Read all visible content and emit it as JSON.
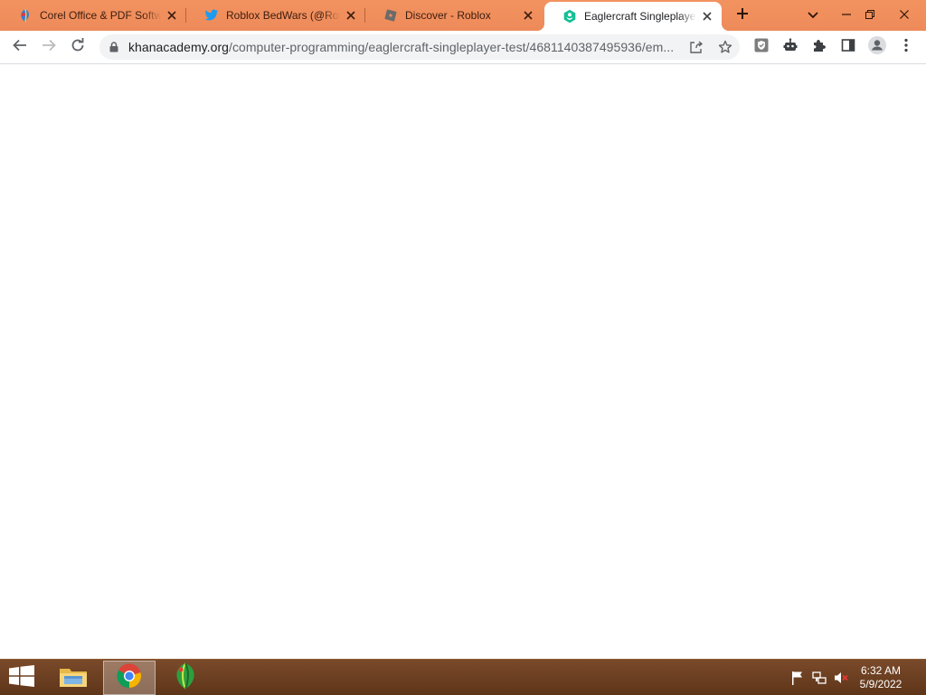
{
  "browser": {
    "tabs": [
      {
        "title": "Corel Office & PDF Software",
        "icon": "corel-favicon",
        "active": false
      },
      {
        "title": "Roblox BedWars (@Roblox_BedWars)",
        "icon": "twitter-favicon",
        "active": false
      },
      {
        "title": "Discover - Roblox",
        "icon": "roblox-favicon",
        "active": false
      },
      {
        "title": "Eaglercraft Singleplayer Test",
        "icon": "khan-academy-favicon",
        "active": true
      }
    ],
    "new_tab_icon": "plus-icon",
    "tab_search_icon": "chevron-down-icon"
  },
  "toolbar": {
    "url_host": "khanacademy.org",
    "url_path": "/computer-programming/eaglercraft-singleplayer-test/4681140387495936/em...",
    "icons": [
      "back-arrow-icon",
      "forward-arrow-icon",
      "reload-icon",
      "lock-icon",
      "share-icon",
      "star-icon",
      "shield-extension-icon",
      "robot-extension-icon",
      "puzzle-extensions-icon",
      "side-panel-icon",
      "profile-icon",
      "kebab-menu-icon"
    ]
  },
  "taskbar": {
    "apps": [
      "windows-start-icon",
      "file-explorer-icon",
      "chrome-icon",
      "coreldraw-icon"
    ],
    "tray_icons": [
      "flag-icon",
      "network-icon",
      "volume-muted-icon"
    ],
    "time": "6:32 AM",
    "date": "5/9/2022"
  },
  "colors": {
    "tabstrip": "#f08a5d",
    "taskbar": "#6b3e20",
    "khan_green": "#14bf96",
    "twitter_blue": "#1d9bf0"
  }
}
